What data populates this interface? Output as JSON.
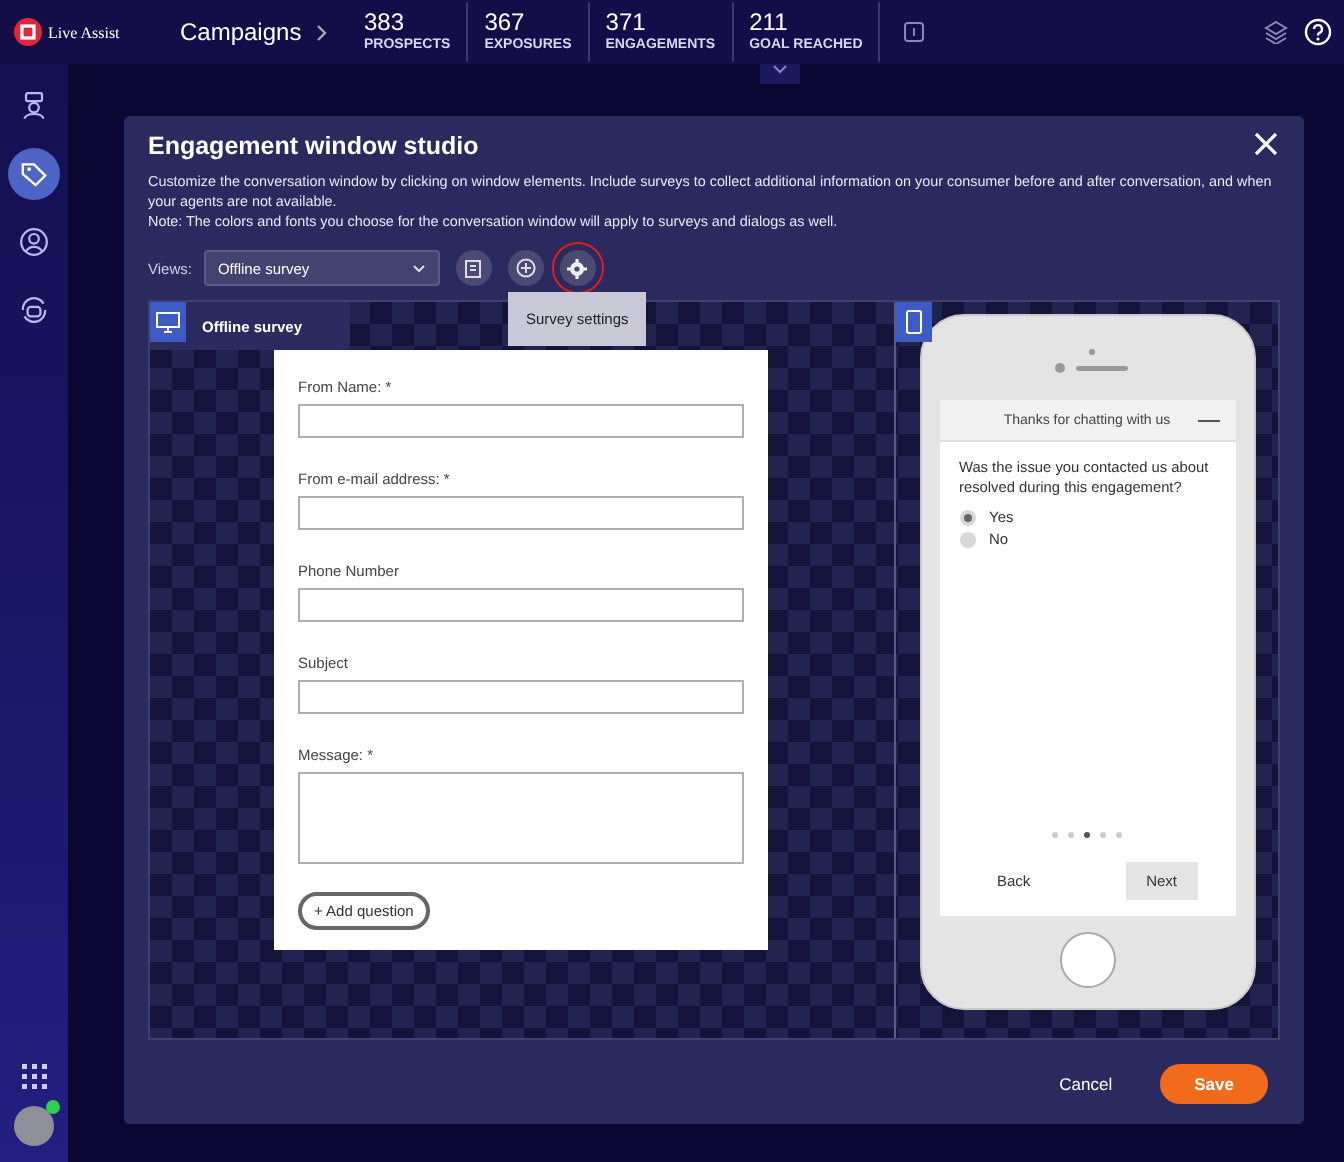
{
  "topbar": {
    "brand": "Live Assist",
    "section": "Campaigns",
    "stats": [
      {
        "value": "383",
        "label": "PROSPECTS"
      },
      {
        "value": "367",
        "label": "EXPOSURES"
      },
      {
        "value": "371",
        "label": "ENGAGEMENTS"
      },
      {
        "value": "211",
        "label": "GOAL REACHED"
      }
    ]
  },
  "sidebar": {
    "items": [
      {
        "selected": false
      },
      {
        "selected": true
      },
      {
        "selected": false
      },
      {
        "selected": false
      }
    ],
    "user": {
      "online": true
    }
  },
  "studio": {
    "title": "Engagement window studio",
    "description": "Customize the conversation window by clicking on window elements. Include surveys to collect additional information on your consumer before and after conversation, and when your agents are not available.",
    "note": "Note: The colors and fonts you choose for the conversation window will apply to surveys and dialogs as well.",
    "views_label": "Views:",
    "views_value": "Offline survey",
    "tooltip": "Survey settings",
    "desktop_label": "Offline survey",
    "form": {
      "fields": [
        {
          "label": "From Name: *",
          "kind": "line"
        },
        {
          "label": "From e-mail address: *",
          "kind": "line"
        },
        {
          "label": "Phone Number",
          "kind": "line"
        },
        {
          "label": "Subject",
          "kind": "line"
        },
        {
          "label": "Message: *",
          "kind": "area"
        }
      ],
      "add_button": "+ Add question"
    },
    "mobile": {
      "header": "Thanks for chatting with us",
      "question": "Was the issue you contacted us about resolved during this engagement?",
      "options": [
        {
          "label": "Yes",
          "selected": true
        },
        {
          "label": "No",
          "selected": false
        }
      ],
      "pager": [
        {
          "selected": false
        },
        {
          "selected": false
        },
        {
          "selected": true
        },
        {
          "selected": false
        },
        {
          "selected": false
        }
      ],
      "back": "Back",
      "next": "Next"
    },
    "buttons": {
      "cancel": "Cancel",
      "save": "Save"
    }
  }
}
